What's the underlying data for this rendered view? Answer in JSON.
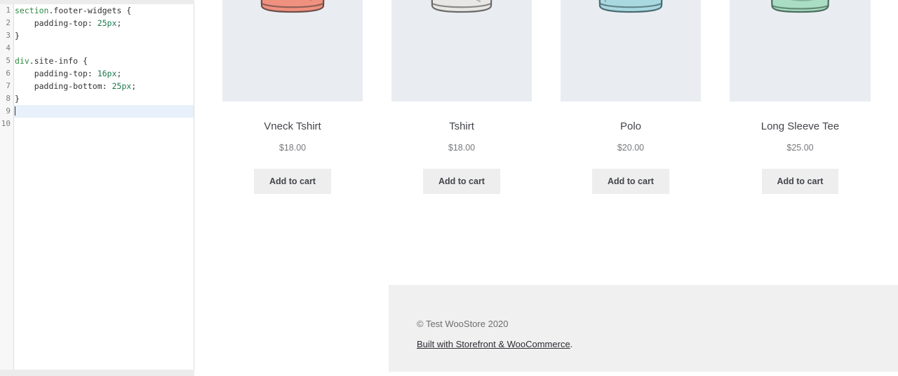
{
  "editor": {
    "name": "additional-css-editor",
    "active_line": 9,
    "total_lines": 10,
    "lines": [
      {
        "num": "1",
        "selector": "section",
        "rest": ".footer-widgets {"
      },
      {
        "num": "2",
        "prop": "    padding-top: ",
        "value": "25px",
        "end": ";"
      },
      {
        "num": "3",
        "plain": "}"
      },
      {
        "num": "4",
        "plain": ""
      },
      {
        "num": "5",
        "selector": "div",
        "rest": ".site-info {"
      },
      {
        "num": "6",
        "prop": "    padding-top: ",
        "value": "16px",
        "end": ";"
      },
      {
        "num": "7",
        "prop": "    padding-bottom: ",
        "value": "25px",
        "end": ";"
      },
      {
        "num": "8",
        "plain": "}"
      },
      {
        "num": "9",
        "plain": ""
      },
      {
        "num": "10",
        "plain": ""
      }
    ],
    "colors": {
      "selector": "#2e8b40",
      "value": "#1a7a4b",
      "plain": "#333333",
      "gutter_bg": "#f7f7f7",
      "active_line_bg": "#e8f0fb"
    }
  },
  "preview": {
    "products": [
      {
        "title": "Vneck Tshirt",
        "price": "$18.00",
        "add_to_cart": "Add to cart",
        "image_name": "vneck-tshirt-image",
        "garment": "vneck-tee",
        "fill": "#f0907e",
        "fill_dark": "#f2705c",
        "stroke": "#6d4f4a",
        "thumb_bg": "#e9edf1"
      },
      {
        "title": "Tshirt",
        "price": "$18.00",
        "add_to_cart": "Add to cart",
        "image_name": "tshirt-image",
        "garment": "crew-tee",
        "fill": "#e9e7e4",
        "fill_dark": "#dedbd6",
        "stroke": "#6a6a6a",
        "thumb_bg": "#e9edf1"
      },
      {
        "title": "Polo",
        "price": "$20.00",
        "add_to_cart": "Add to cart",
        "image_name": "polo-image",
        "garment": "polo",
        "fill": "#a9d8e0",
        "fill_dark": "#8fc9d4",
        "stroke": "#4b6a72",
        "thumb_bg": "#e9edf1"
      },
      {
        "title": "Long Sleeve Tee",
        "price": "$25.00",
        "add_to_cart": "Add to cart",
        "image_name": "long-sleeve-tee-image",
        "garment": "long-sleeve",
        "fill": "#a9ddc4",
        "fill_dark": "#93d1b3",
        "stroke": "#4d6f5e",
        "thumb_bg": "#e9edf1"
      }
    ]
  },
  "footer": {
    "copyright": "© Test WooStore 2020",
    "built_with_link": "Built with Storefront & WooCommerce",
    "built_with_period": ".",
    "bg": "#f0f0f0"
  }
}
